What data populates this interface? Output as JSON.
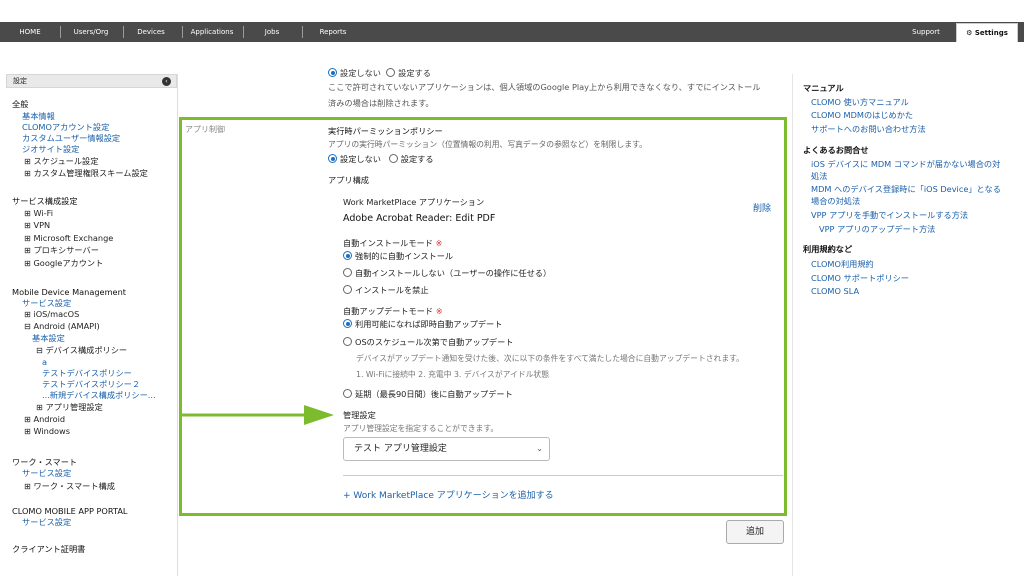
{
  "nav": {
    "items": [
      "HOME",
      "Users/Org",
      "Devices",
      "Applications",
      "Jobs",
      "Reports"
    ],
    "support": "Support",
    "settings": "Settings"
  },
  "sidebar": {
    "header": "設定",
    "entries": [
      {
        "text": "全般",
        "kind": "h"
      },
      {
        "text": "基本情報",
        "kind": "l"
      },
      {
        "text": "CLOMOアカウント設定",
        "kind": "l"
      },
      {
        "text": "カスタムユーザー情報設定",
        "kind": "l"
      },
      {
        "text": "ジオサイト設定",
        "kind": "l"
      },
      {
        "text": "⊞ スケジュール設定",
        "kind": "t"
      },
      {
        "text": "⊞ カスタム管理権限スキーム設定",
        "kind": "t"
      },
      {
        "text": "サービス構成設定",
        "kind": "h"
      },
      {
        "text": "⊞ Wi-Fi",
        "kind": "t"
      },
      {
        "text": "⊞ VPN",
        "kind": "t"
      },
      {
        "text": "⊞ Microsoft Exchange",
        "kind": "t"
      },
      {
        "text": "⊞ プロキシサーバー",
        "kind": "t"
      },
      {
        "text": "⊞ Googleアカウント",
        "kind": "t"
      },
      {
        "text": "Mobile Device Management",
        "kind": "h"
      },
      {
        "text": "サービス設定",
        "kind": "l"
      },
      {
        "text": "⊞ iOS/macOS",
        "kind": "t"
      },
      {
        "text": "⊟ Android (AMAPI)",
        "kind": "t"
      },
      {
        "text": "基本設定",
        "kind": "l"
      },
      {
        "text": "⊟ デバイス構成ポリシー",
        "kind": "t"
      },
      {
        "text": "a",
        "kind": "l"
      },
      {
        "text": "テストデバイスポリシー",
        "kind": "l"
      },
      {
        "text": "テストデバイスポリシー２",
        "kind": "l"
      },
      {
        "text": "...新規デバイス構成ポリシー...",
        "kind": "l"
      },
      {
        "text": "⊞ アプリ管理設定",
        "kind": "t"
      },
      {
        "text": "⊞ Android",
        "kind": "t"
      },
      {
        "text": "⊞ Windows",
        "kind": "t"
      },
      {
        "text": "ワーク・スマート",
        "kind": "h"
      },
      {
        "text": "サービス設定",
        "kind": "l"
      },
      {
        "text": "⊞ ワーク・スマート構成",
        "kind": "t"
      },
      {
        "text": "CLOMO MOBILE APP PORTAL",
        "kind": "h"
      },
      {
        "text": "サービス設定",
        "kind": "l"
      },
      {
        "text": "クライアント証明書",
        "kind": "h"
      }
    ]
  },
  "top": {
    "radio_off": "設定しない",
    "radio_on": "設定する",
    "note1": "ここで許可されていないアプリケーションは、個人領域のGoogle Play上から利用できなくなり、すでにインストール",
    "note2": "済みの場合は削除されます。"
  },
  "panel": {
    "section_label": "アプリ制御",
    "runtime_title": "実行時パーミッションポリシー",
    "runtime_desc": "アプリの実行時パーミッション（位置情報の利用、写真データの参照など）を制限します。",
    "runtime_off": "設定しない",
    "runtime_on": "設定する",
    "app_config": "アプリ構成",
    "wm_label": "Work MarketPlace アプリケーション",
    "app_name": "Adobe Acrobat Reader: Edit PDF",
    "delete": "削除",
    "install_mode": "自動インストールモード",
    "install_opt1": "強制的に自動インストール",
    "install_opt2": "自動インストールしない（ユーザーの操作に任せる）",
    "install_opt3": "インストールを禁止",
    "update_mode": "自動アップデートモード",
    "update_opt1": "利用可能になれば即時自動アップデート",
    "update_opt2": "OSのスケジュール次第で自動アップデート",
    "update_desc1": "デバイスがアップデート通知を受けた後、次に以下の条件をすべて満たした場合に自動アップデートされます。",
    "update_desc2": "1. Wi-Fiに接続中 2. 充電中 3. デバイスがアイドル状態",
    "update_opt3": "延期（最長90日間）後に自動アップデート",
    "required_mark": "※",
    "mgmt_title": "管理設定",
    "mgmt_desc": "アプリ管理設定を指定することができます。",
    "mgmt_selected": "テスト アプリ管理設定",
    "add_link": "+ Work MarketPlace アプリケーションを追加する"
  },
  "add_button": "追加",
  "right": {
    "manual_title": "マニュアル",
    "manual_links": [
      "CLOMO 使い方マニュアル",
      "CLOMO MDMのはじめかた",
      "サポートへのお問い合わせ方法"
    ],
    "faq_title": "よくあるお問合せ",
    "faq_links": [
      "iOS デバイスに MDM コマンドが届かない場合の対",
      "処法",
      "MDM へのデバイス登録時に「iOS Device」となる",
      "場合の対処法",
      "VPP アプリを手動でインストールする方法",
      "VPP アプリのアップデート方法"
    ],
    "terms_title": "利用規約など",
    "terms_links": [
      "CLOMO利用規約",
      "CLOMO サポートポリシー",
      "CLOMO SLA"
    ]
  },
  "colors": {
    "accent": "#7dbb2e",
    "link": "#1a5faa",
    "nav": "#4a4a4a"
  }
}
